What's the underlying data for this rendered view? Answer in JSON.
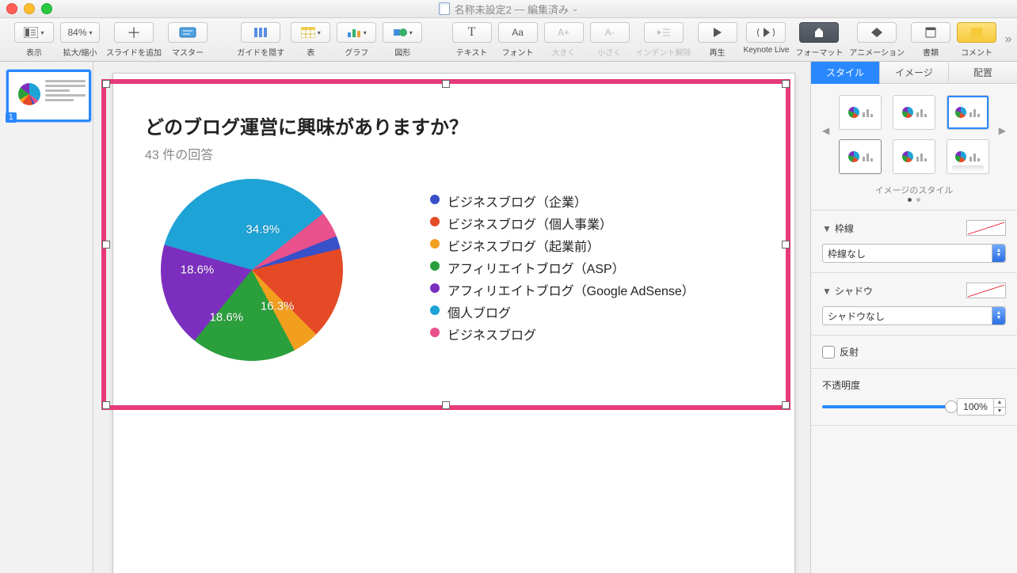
{
  "window": {
    "doc_title": "名称未設定2",
    "status": "編集済み"
  },
  "toolbar": {
    "view": "表示",
    "zoom": "拡大/縮小",
    "zoom_value": "84%",
    "add_slide": "スライドを追加",
    "master": "マスター",
    "hide_guides": "ガイドを隠す",
    "table": "表",
    "chart": "グラフ",
    "shape": "図形",
    "text": "テキスト",
    "font": "フォント",
    "bigger": "大きく",
    "smaller": "小さく",
    "outdent": "インデント解除",
    "play": "再生",
    "keynote_live": "Keynote Live",
    "format": "フォーマット",
    "animation": "アニメーション",
    "documents": "書類",
    "comment": "コメント",
    "text_glyph": "T",
    "font_glyph": "Aa",
    "bigger_glyph": "A+",
    "smaller_glyph": "A-"
  },
  "navigator": {
    "slide_number": "1"
  },
  "chart_data": {
    "type": "pie",
    "title": "どのブログ運営に興味がありますか？",
    "subtitle": "43 件の回答",
    "series": [
      {
        "name": "ビジネスブログ（企業）",
        "value": 2.3,
        "color": "#3850c8"
      },
      {
        "name": "ビジネスブログ（個人事業）",
        "value": 16.3,
        "color": "#e54a27"
      },
      {
        "name": "ビジネスブログ（起業前）",
        "value": 4.7,
        "color": "#f29e1f"
      },
      {
        "name": "アフィリエイトブログ（ASP）",
        "value": 18.6,
        "color": "#2b9f3c"
      },
      {
        "name": "アフィリエイトブログ（Google AdSense）",
        "value": 18.6,
        "color": "#7c2fbf"
      },
      {
        "name": "個人ブログ",
        "value": 34.9,
        "color": "#1ea3d6"
      },
      {
        "name": "ビジネスブログ",
        "value": 4.6,
        "color": "#e9518c"
      }
    ],
    "labels_shown": [
      {
        "text": "34.9%",
        "x": 56,
        "y": 28
      },
      {
        "text": "18.6%",
        "x": 20,
        "y": 50
      },
      {
        "text": "18.6%",
        "x": 36,
        "y": 76
      },
      {
        "text": "16.3%",
        "x": 64,
        "y": 70
      }
    ]
  },
  "inspector": {
    "tabs": {
      "style": "スタイル",
      "image": "イメージ",
      "arrange": "配置"
    },
    "image_style_label": "イメージのスタイル",
    "border_label": "枠線",
    "border_value": "枠線なし",
    "shadow_label": "シャドウ",
    "shadow_value": "シャドウなし",
    "reflection_label": "反射",
    "opacity_label": "不透明度",
    "opacity_value": "100%"
  }
}
